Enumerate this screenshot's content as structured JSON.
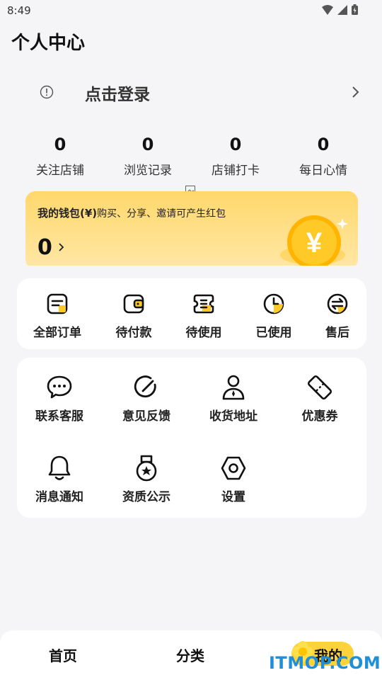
{
  "status_bar": {
    "time": "8:49"
  },
  "header": {
    "title": "个人中心"
  },
  "login": {
    "label": "点击登录"
  },
  "stats": [
    {
      "value": "0",
      "label": "关注店铺"
    },
    {
      "value": "0",
      "label": "浏览记录"
    },
    {
      "value": "0",
      "label": "店铺打卡"
    },
    {
      "value": "0",
      "label": "每日心情"
    }
  ],
  "wallet": {
    "title": "我的钱包(¥)",
    "subtitle": "购买、分享、邀请可产生红包",
    "amount": "0",
    "coin_symbol": "¥"
  },
  "orders": [
    {
      "label": "全部订单",
      "icon": "order-list-icon"
    },
    {
      "label": "待付款",
      "icon": "wallet-icon"
    },
    {
      "label": "待使用",
      "icon": "ticket-icon"
    },
    {
      "label": "已使用",
      "icon": "clock-icon"
    },
    {
      "label": "售后",
      "icon": "exchange-icon"
    }
  ],
  "services": [
    {
      "label": "联系客服",
      "icon": "chat-icon"
    },
    {
      "label": "意见反馈",
      "icon": "feedback-icon"
    },
    {
      "label": "收货地址",
      "icon": "person-icon"
    },
    {
      "label": "优惠券",
      "icon": "coupon-icon"
    },
    {
      "label": "消息通知",
      "icon": "bell-icon"
    },
    {
      "label": "资质公示",
      "icon": "medal-icon"
    },
    {
      "label": "设置",
      "icon": "settings-icon"
    }
  ],
  "tabbar": [
    {
      "label": "首页"
    },
    {
      "label": "分类"
    },
    {
      "label": "我的"
    }
  ],
  "watermark": "ITMOP.COM",
  "colors": {
    "accent": "#ffd23a",
    "wallet_top": "#ffd86c",
    "wallet_bottom": "#ffe7a6",
    "watermark": "#1f8fd8"
  }
}
